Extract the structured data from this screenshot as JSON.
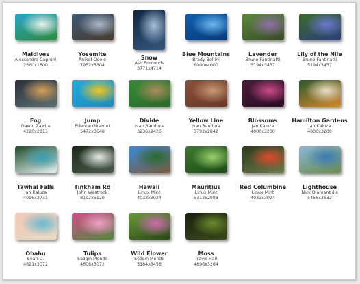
{
  "wallpapers": [
    {
      "name": "Maldives",
      "author": "Alessandro Caproni",
      "resolution": "2560x1600",
      "colors": [
        "#2aa7c9",
        "#e9f2ef",
        "#2b8a3b"
      ],
      "icon": "beach-thumbnail"
    },
    {
      "name": "Yosemite",
      "author": "Aniket Deole",
      "resolution": "7952x5304",
      "colors": [
        "#3d5a78",
        "#a9b8c9",
        "#4a3a2e"
      ],
      "icon": "valley-thumbnail"
    },
    {
      "name": "Snow",
      "author": "Ash Edmonds",
      "resolution": "3771x4714",
      "colors": [
        "#0d2540",
        "#a7c0d8",
        "#34557a"
      ],
      "icon": "snow-thumbnail"
    },
    {
      "name": "Blue Mountains",
      "author": "Brady Bellini",
      "resolution": "6000x4000",
      "colors": [
        "#0e5fb0",
        "#6cb8f0",
        "#0a3a77"
      ],
      "icon": "mountains-thumbnail"
    },
    {
      "name": "Lavender",
      "author": "Bruno Fantinatti",
      "resolution": "5194x3457",
      "colors": [
        "#5c8a3c",
        "#8f6fa8",
        "#3a4a2a"
      ],
      "icon": "lavender-thumbnail"
    },
    {
      "name": "Lily of the Nile",
      "author": "Bruno Fantinatti",
      "resolution": "5194x3457",
      "colors": [
        "#3c6b2a",
        "#6c78d0",
        "#2c3f7a"
      ],
      "icon": "lily-thumbnail"
    },
    {
      "name": "Fog",
      "author": "Dawid Zawila",
      "resolution": "4220x2813",
      "colors": [
        "#2a2f3a",
        "#d8a058",
        "#5a6f70"
      ],
      "icon": "fog-thumbnail"
    },
    {
      "name": "Jump",
      "author": "Etienne Girardet",
      "resolution": "5472x3648",
      "colors": [
        "#1fa9dc",
        "#f5c518",
        "#1a8fc0"
      ],
      "icon": "jump-thumbnail"
    },
    {
      "name": "Divide",
      "author": "Ivan Bandura",
      "resolution": "3236x2426",
      "colors": [
        "#3a8a3a",
        "#b08a5a",
        "#2a6a2a"
      ],
      "icon": "divide-thumbnail"
    },
    {
      "name": "Yellow Line",
      "author": "Ivan Bandura",
      "resolution": "3792x2842",
      "colors": [
        "#8a4f3a",
        "#c89a72",
        "#6a3828"
      ],
      "icon": "yellow-line-thumbnail"
    },
    {
      "name": "Blossoms",
      "author": "Jan Kaluza",
      "resolution": "4800x3200",
      "colors": [
        "#4a1b3a",
        "#d04a8a",
        "#2a0f24"
      ],
      "icon": "blossoms-thumbnail"
    },
    {
      "name": "Hamilton Gardens",
      "author": "Jan Kaluza",
      "resolution": "4800x3200",
      "colors": [
        "#2d5a2a",
        "#e8e0c8",
        "#d8862a"
      ],
      "icon": "garden-thumbnail"
    },
    {
      "name": "Tawhai Falls",
      "author": "Jan Kaluza",
      "resolution": "4096x2731",
      "colors": [
        "#1f4a2a",
        "#3aa0b0",
        "#e6f2f2"
      ],
      "icon": "waterfall-thumbnail"
    },
    {
      "name": "Tinkham Rd",
      "author": "John Westrock",
      "resolution": "8192x5120",
      "colors": [
        "#1a2a1a",
        "#e8eaea",
        "#4a5a4a"
      ],
      "icon": "forest-road-thumbnail"
    },
    {
      "name": "Hawaii",
      "author": "Linux Mint",
      "resolution": "4032x3024",
      "colors": [
        "#3a8ad8",
        "#2a6a2a",
        "#7a5a3a"
      ],
      "icon": "tree-thumbnail"
    },
    {
      "name": "Mauritius",
      "author": "Linux Mint",
      "resolution": "5312x2988",
      "colors": [
        "#3a7a2a",
        "#9ad06a",
        "#1f4a1a"
      ],
      "icon": "foliage-thumbnail"
    },
    {
      "name": "Red Columbine",
      "author": "Linux Mint",
      "resolution": "4032x3024",
      "colors": [
        "#2a3a1a",
        "#e04a2a",
        "#6a7a4a"
      ],
      "icon": "columbine-thumbnail"
    },
    {
      "name": "Lighthouse",
      "author": "Nick Diamantidis",
      "resolution": "5456x3632",
      "colors": [
        "#8ab8d8",
        "#3a7ab0",
        "#6a8a4a"
      ],
      "icon": "lighthouse-thumbnail"
    },
    {
      "name": "Ohahu",
      "author": "Sean O.",
      "resolution": "4621x3072",
      "colors": [
        "#f0c8b8",
        "#6ab8d0",
        "#e8d8c0"
      ],
      "icon": "sunset-beach-thumbnail"
    },
    {
      "name": "Tulips",
      "author": "Sezgin Mendil",
      "resolution": "4608x3072",
      "colors": [
        "#d84a8a",
        "#f0a0c8",
        "#4a8a3a"
      ],
      "icon": "tulips-thumbnail"
    },
    {
      "name": "Wild Flower",
      "author": "Sezgin Mendil",
      "resolution": "5184x3456",
      "colors": [
        "#6a9a3a",
        "#d06ab0",
        "#2a4a1a"
      ],
      "icon": "wildflower-thumbnail"
    },
    {
      "name": "Moss",
      "author": "Travis Hall",
      "resolution": "4896x3264",
      "colors": [
        "#1a1f10",
        "#6a8a2a",
        "#3a4a1a"
      ],
      "icon": "moss-thumbnail"
    }
  ]
}
